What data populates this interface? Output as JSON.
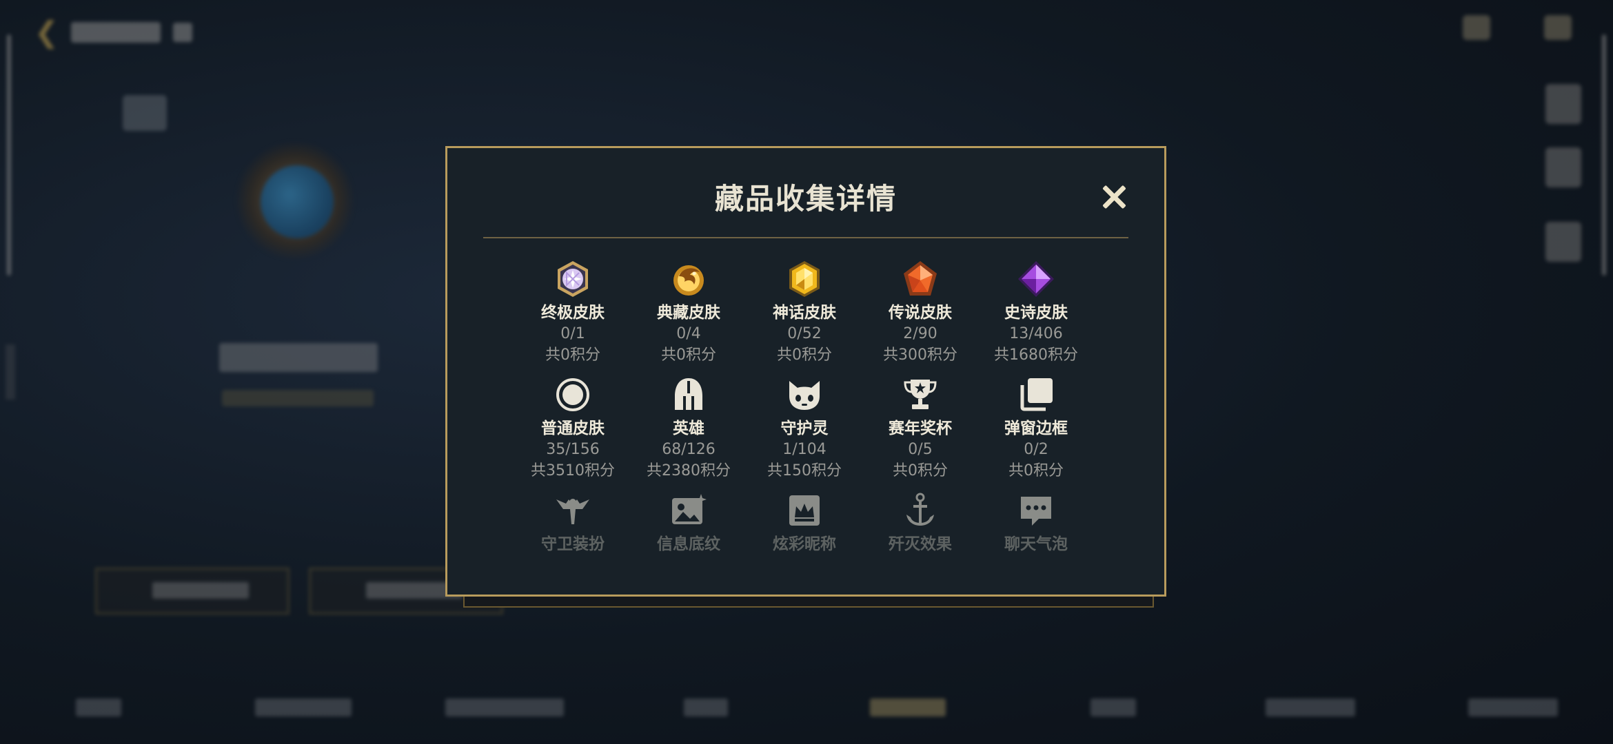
{
  "modal": {
    "title": "藏品收集详情",
    "close_label": "×"
  },
  "categories": [
    {
      "label": "终极皮肤",
      "count": "0/1",
      "points": "共0积分",
      "icon": "ultimate-gem-icon"
    },
    {
      "label": "典藏皮肤",
      "count": "0/4",
      "points": "共0积分",
      "icon": "treasure-dragon-icon"
    },
    {
      "label": "神话皮肤",
      "count": "0/52",
      "points": "共0积分",
      "icon": "mythic-gem-icon"
    },
    {
      "label": "传说皮肤",
      "count": "2/90",
      "points": "共300积分",
      "icon": "legendary-gem-icon"
    },
    {
      "label": "史诗皮肤",
      "count": "13/406",
      "points": "共1680积分",
      "icon": "epic-gem-icon"
    },
    {
      "label": "普通皮肤",
      "count": "35/156",
      "points": "共3510积分",
      "icon": "normal-skin-icon"
    },
    {
      "label": "英雄",
      "count": "68/126",
      "points": "共2380积分",
      "icon": "hero-helmet-icon"
    },
    {
      "label": "守护灵",
      "count": "1/104",
      "points": "共150积分",
      "icon": "guardian-spirit-icon"
    },
    {
      "label": "赛年奖杯",
      "count": "0/5",
      "points": "共0积分",
      "icon": "trophy-icon"
    },
    {
      "label": "弹窗边框",
      "count": "0/2",
      "points": "共0积分",
      "icon": "popup-frame-icon"
    },
    {
      "label": "守卫装扮",
      "icon": "ward-skin-icon"
    },
    {
      "label": "信息底纹",
      "icon": "info-card-icon"
    },
    {
      "label": "炫彩昵称",
      "icon": "colorful-nickname-icon"
    },
    {
      "label": "歼灭效果",
      "icon": "kill-effect-icon"
    },
    {
      "label": "聊天气泡",
      "icon": "chat-bubble-icon"
    }
  ]
}
